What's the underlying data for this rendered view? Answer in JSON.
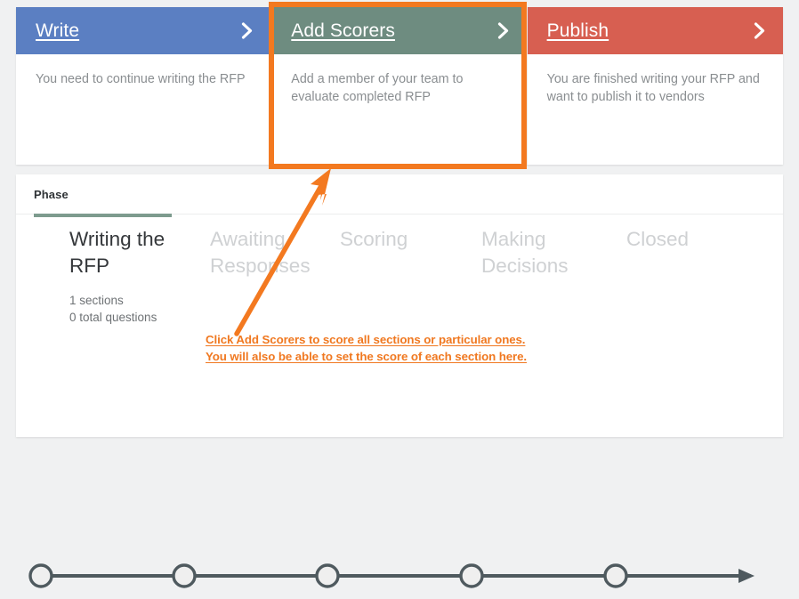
{
  "cards": [
    {
      "title": "Write",
      "description": "You need to continue writing the RFP",
      "color": "#5b7fc2",
      "chevron_icon": "chevron-right-icon"
    },
    {
      "title": "Add Scorers",
      "description": "Add a member of your team to evaluate completed RFP",
      "color": "#6e8c80",
      "chevron_icon": "chevron-right-icon"
    },
    {
      "title": "Publish",
      "description": "You are finished writing your RFP and want to publish it to vendors",
      "color": "#d75f51",
      "chevron_icon": "chevron-right-icon"
    }
  ],
  "panel": {
    "header_label": "Phase",
    "active_indicator_color": "#7d9b8e"
  },
  "phases": [
    {
      "name": "Writing the RFP",
      "current": true,
      "meta_line_1": "1 sections",
      "meta_line_2": "0 total questions"
    },
    {
      "name": "Awaiting Responses",
      "current": false
    },
    {
      "name": "Scoring",
      "current": false
    },
    {
      "name": "Making Decisions",
      "current": false
    },
    {
      "name": "Closed",
      "current": false
    }
  ],
  "timeline": {
    "node_count": 5,
    "node_fill": "#efefef",
    "node_stroke": "#4f5a5f",
    "line_color": "#4f5a5f"
  },
  "annotation": {
    "accent_color": "#f37920",
    "highlight_target": "Add Scorers card",
    "arrow_icon": "arrow-up-right-icon",
    "text_line_1": "Click Add Scorers to score all sections or particular ones.",
    "text_line_2": "You will also be able to set the score of each section here."
  }
}
